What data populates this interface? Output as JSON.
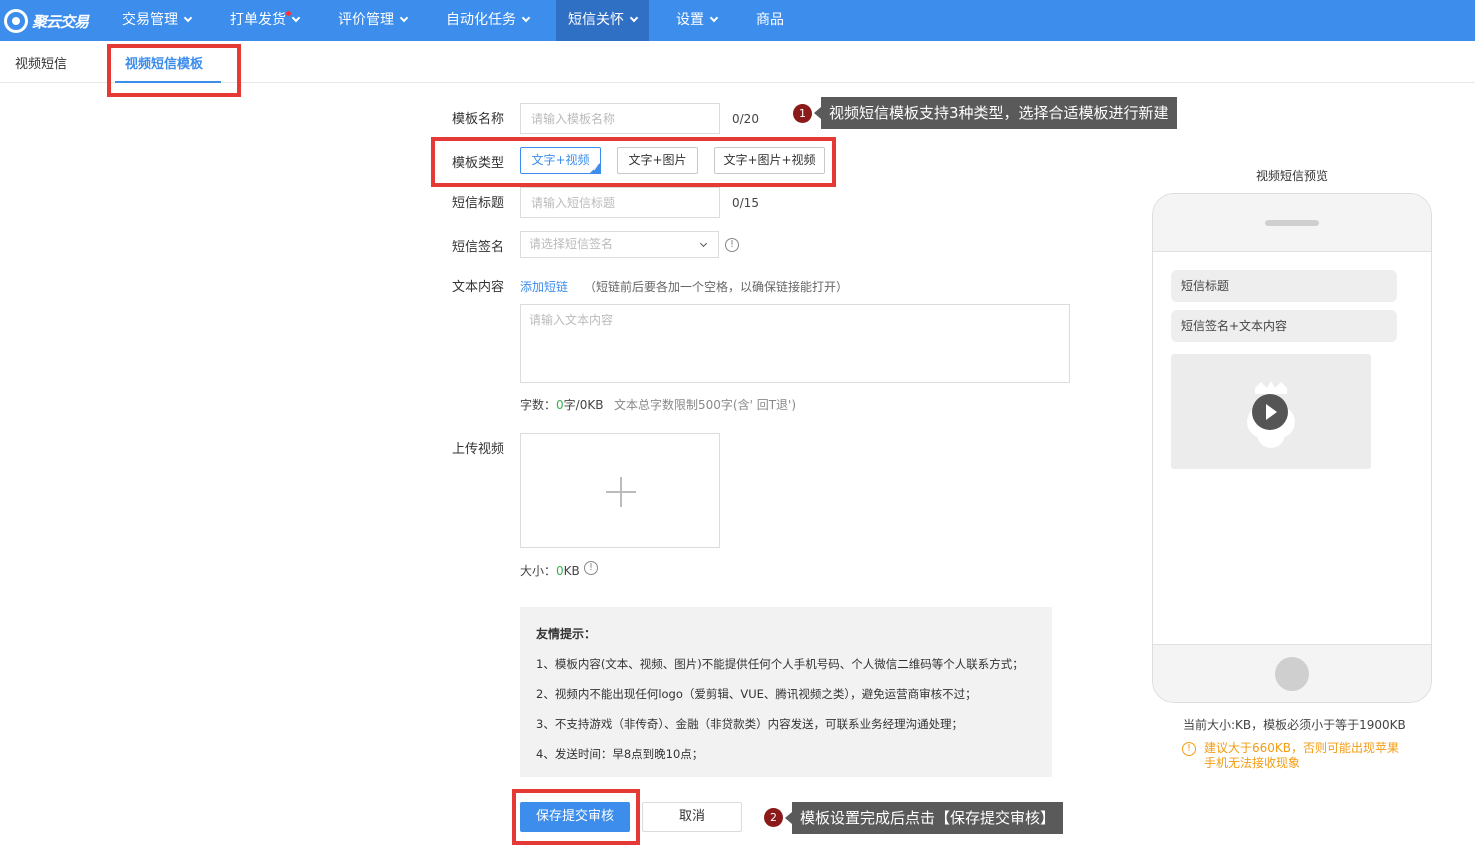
{
  "nav": {
    "logo": "聚云交易",
    "items": [
      {
        "label": "交易管理",
        "has_menu": true
      },
      {
        "label": "打单发货",
        "has_menu": true,
        "has_dot": true
      },
      {
        "label": "评价管理",
        "has_menu": true
      },
      {
        "label": "自动化任务",
        "has_menu": true
      },
      {
        "label": "短信关怀",
        "has_menu": true,
        "active": true
      },
      {
        "label": "设置",
        "has_menu": true
      },
      {
        "label": "商品",
        "has_menu": false
      }
    ]
  },
  "subtabs": [
    {
      "label": "视频短信",
      "active": false
    },
    {
      "label": "视频短信模板",
      "active": true
    }
  ],
  "form": {
    "template_name": {
      "label": "模板名称",
      "placeholder": "请输入模板名称",
      "counter": "0/20"
    },
    "template_type": {
      "label": "模板类型",
      "options": [
        "文字+视频",
        "文字+图片",
        "文字+图片+视频"
      ],
      "selected": "文字+视频"
    },
    "sms_title": {
      "label": "短信标题",
      "placeholder": "请输入短信标题",
      "counter": "0/15"
    },
    "sms_signature": {
      "label": "短信签名",
      "placeholder": "请选择短信签名"
    },
    "text_content": {
      "label": "文本内容",
      "add_link": "添加短链",
      "hint": "（短链前后要各加一个空格，以确保链接能打开）",
      "placeholder": "请输入文本内容",
      "count_label": "字数：",
      "count_value": "0",
      "count_suffix": "字/0KB",
      "limit_text": "文本总字数限制500字(含' 回T退')"
    },
    "upload_video": {
      "label": "上传视频",
      "size_label": "大小：",
      "size_value": "0",
      "size_suffix": "KB"
    }
  },
  "tips": {
    "title": "友情提示：",
    "lines": [
      "1、模板内容(文本、视频、图片)不能提供任何个人手机号码、个人微信二维码等个人联系方式；",
      "2、视频内不能出现任何logo（爱剪辑、VUE、腾讯视频之类），避免运营商审核不过；",
      "3、不支持游戏（非传奇）、金融（非贷款类）内容发送，可联系业务经理沟通处理；",
      "4、发送时间：早8点到晚10点；"
    ]
  },
  "buttons": {
    "save": "保存提交审核",
    "cancel": "取消"
  },
  "callouts": [
    {
      "num": "1",
      "text": "视频短信模板支持3种类型，选择合适模板进行新建"
    },
    {
      "num": "2",
      "text": "模板设置完成后点击【保存提交审核】"
    }
  ],
  "preview": {
    "title": "视频短信预览",
    "sms_title": "短信标题",
    "sms_body": "短信签名+文本内容",
    "size_info": "当前大小:KB，模板必须小于等于1900KB",
    "warning_line1": "建议大于660KB，否则可能出现苹果",
    "warning_line2": "手机无法接收现象"
  },
  "colors": {
    "nav_bg": "#3c8dec",
    "nav_active": "#2f6fc4",
    "annotation_red": "#e53935",
    "warning": "#f39c12",
    "count_green": "#36b34a"
  }
}
